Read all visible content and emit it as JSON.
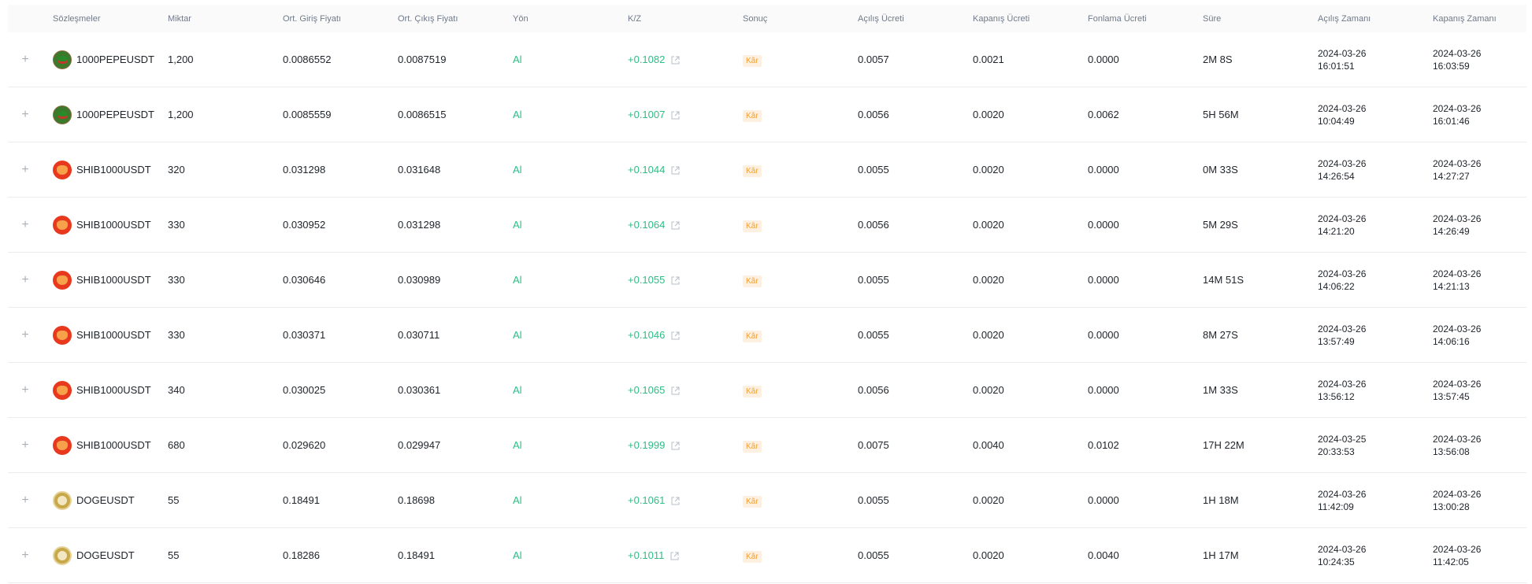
{
  "columns": {
    "contract": "Sözleşmeler",
    "qty": "Miktar",
    "entry": "Ort. Giriş Fiyatı",
    "exit": "Ort. Çıkış Fiyatı",
    "side": "Yön",
    "pnl": "K/Z",
    "result": "Sonuç",
    "open_fee": "Açılış Ücreti",
    "close_fee": "Kapanış Ücreti",
    "funding_fee": "Fonlama Ücreti",
    "duration": "Süre",
    "open_time": "Açılış Zamanı",
    "close_time": "Kapanış Zamanı"
  },
  "rows": [
    {
      "coin": "pepe",
      "symbol": "1000PEPEUSDT",
      "qty": "1,200",
      "entry": "0.0086552",
      "exit": "0.0087519",
      "side": "Al",
      "pnl": "+0.1082",
      "result": "Kâr",
      "open_fee": "0.0057",
      "close_fee": "0.0021",
      "funding_fee": "0.0000",
      "duration": "2M 8S",
      "open_date": "2024-03-26",
      "open_clock": "16:01:51",
      "close_date": "2024-03-26",
      "close_clock": "16:03:59"
    },
    {
      "coin": "pepe",
      "symbol": "1000PEPEUSDT",
      "qty": "1,200",
      "entry": "0.0085559",
      "exit": "0.0086515",
      "side": "Al",
      "pnl": "+0.1007",
      "result": "Kâr",
      "open_fee": "0.0056",
      "close_fee": "0.0020",
      "funding_fee": "0.0062",
      "duration": "5H 56M",
      "open_date": "2024-03-26",
      "open_clock": "10:04:49",
      "close_date": "2024-03-26",
      "close_clock": "16:01:46"
    },
    {
      "coin": "shib",
      "symbol": "SHIB1000USDT",
      "qty": "320",
      "entry": "0.031298",
      "exit": "0.031648",
      "side": "Al",
      "pnl": "+0.1044",
      "result": "Kâr",
      "open_fee": "0.0055",
      "close_fee": "0.0020",
      "funding_fee": "0.0000",
      "duration": "0M 33S",
      "open_date": "2024-03-26",
      "open_clock": "14:26:54",
      "close_date": "2024-03-26",
      "close_clock": "14:27:27"
    },
    {
      "coin": "shib",
      "symbol": "SHIB1000USDT",
      "qty": "330",
      "entry": "0.030952",
      "exit": "0.031298",
      "side": "Al",
      "pnl": "+0.1064",
      "result": "Kâr",
      "open_fee": "0.0056",
      "close_fee": "0.0020",
      "funding_fee": "0.0000",
      "duration": "5M 29S",
      "open_date": "2024-03-26",
      "open_clock": "14:21:20",
      "close_date": "2024-03-26",
      "close_clock": "14:26:49"
    },
    {
      "coin": "shib",
      "symbol": "SHIB1000USDT",
      "qty": "330",
      "entry": "0.030646",
      "exit": "0.030989",
      "side": "Al",
      "pnl": "+0.1055",
      "result": "Kâr",
      "open_fee": "0.0055",
      "close_fee": "0.0020",
      "funding_fee": "0.0000",
      "duration": "14M 51S",
      "open_date": "2024-03-26",
      "open_clock": "14:06:22",
      "close_date": "2024-03-26",
      "close_clock": "14:21:13"
    },
    {
      "coin": "shib",
      "symbol": "SHIB1000USDT",
      "qty": "330",
      "entry": "0.030371",
      "exit": "0.030711",
      "side": "Al",
      "pnl": "+0.1046",
      "result": "Kâr",
      "open_fee": "0.0055",
      "close_fee": "0.0020",
      "funding_fee": "0.0000",
      "duration": "8M 27S",
      "open_date": "2024-03-26",
      "open_clock": "13:57:49",
      "close_date": "2024-03-26",
      "close_clock": "14:06:16"
    },
    {
      "coin": "shib",
      "symbol": "SHIB1000USDT",
      "qty": "340",
      "entry": "0.030025",
      "exit": "0.030361",
      "side": "Al",
      "pnl": "+0.1065",
      "result": "Kâr",
      "open_fee": "0.0056",
      "close_fee": "0.0020",
      "funding_fee": "0.0000",
      "duration": "1M 33S",
      "open_date": "2024-03-26",
      "open_clock": "13:56:12",
      "close_date": "2024-03-26",
      "close_clock": "13:57:45"
    },
    {
      "coin": "shib",
      "symbol": "SHIB1000USDT",
      "qty": "680",
      "entry": "0.029620",
      "exit": "0.029947",
      "side": "Al",
      "pnl": "+0.1999",
      "result": "Kâr",
      "open_fee": "0.0075",
      "close_fee": "0.0040",
      "funding_fee": "0.0102",
      "duration": "17H 22M",
      "open_date": "2024-03-25",
      "open_clock": "20:33:53",
      "close_date": "2024-03-26",
      "close_clock": "13:56:08"
    },
    {
      "coin": "doge",
      "symbol": "DOGEUSDT",
      "qty": "55",
      "entry": "0.18491",
      "exit": "0.18698",
      "side": "Al",
      "pnl": "+0.1061",
      "result": "Kâr",
      "open_fee": "0.0055",
      "close_fee": "0.0020",
      "funding_fee": "0.0000",
      "duration": "1H 18M",
      "open_date": "2024-03-26",
      "open_clock": "11:42:09",
      "close_date": "2024-03-26",
      "close_clock": "13:00:28"
    },
    {
      "coin": "doge",
      "symbol": "DOGEUSDT",
      "qty": "55",
      "entry": "0.18286",
      "exit": "0.18491",
      "side": "Al",
      "pnl": "+0.1011",
      "result": "Kâr",
      "open_fee": "0.0055",
      "close_fee": "0.0020",
      "funding_fee": "0.0040",
      "duration": "1H 17M",
      "open_date": "2024-03-26",
      "open_clock": "10:24:35",
      "close_date": "2024-03-26",
      "close_clock": "11:42:05"
    }
  ],
  "expand_glyph": "+",
  "colors": {
    "profit": "#2ebd85",
    "badge_bg": "#fdf0e1",
    "badge_text": "#f0a035"
  }
}
